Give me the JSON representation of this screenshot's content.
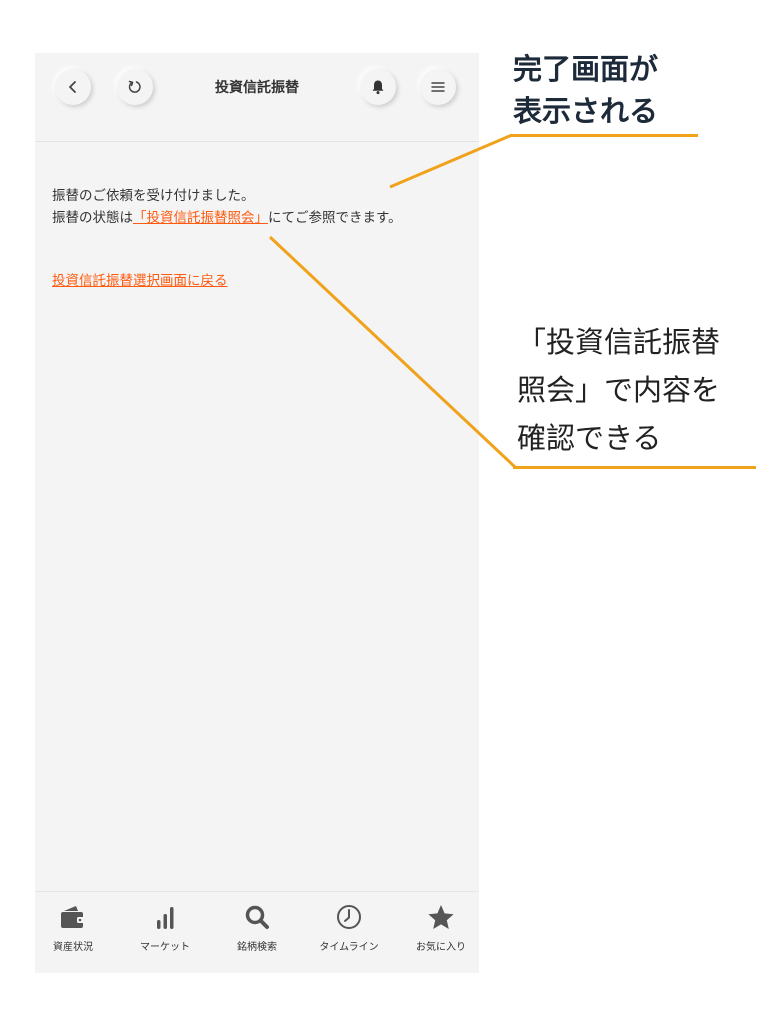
{
  "header": {
    "title": "投資信託振替",
    "icons": [
      "back-icon",
      "refresh-icon",
      "bell-icon",
      "menu-icon"
    ]
  },
  "content": {
    "line1": "振替のご依頼を受け付けました。",
    "line2_prefix": "振替の状態は",
    "line2_link": "「投資信託振替照会」",
    "line2_suffix": "にてご参照できます。",
    "back_link": "投資信託振替選択画面に戻る"
  },
  "tabs": [
    {
      "label": "資産状況",
      "icon": "wallet-icon"
    },
    {
      "label": "マーケット",
      "icon": "bar-chart-icon"
    },
    {
      "label": "銘柄検索",
      "icon": "search-icon"
    },
    {
      "label": "タイムライン",
      "icon": "clock-icon"
    },
    {
      "label": "お気に入り",
      "icon": "star-icon"
    }
  ],
  "annotations": {
    "top_line1": "完了画面が",
    "top_line2": "表示される",
    "bottom_line1": "「投資信託振替",
    "bottom_line2": "照会」で内容を",
    "bottom_line3": "確認できる"
  },
  "colors": {
    "link": "#ff5a0e",
    "callout": "#f0a21b",
    "background": "#f4f4f4"
  }
}
